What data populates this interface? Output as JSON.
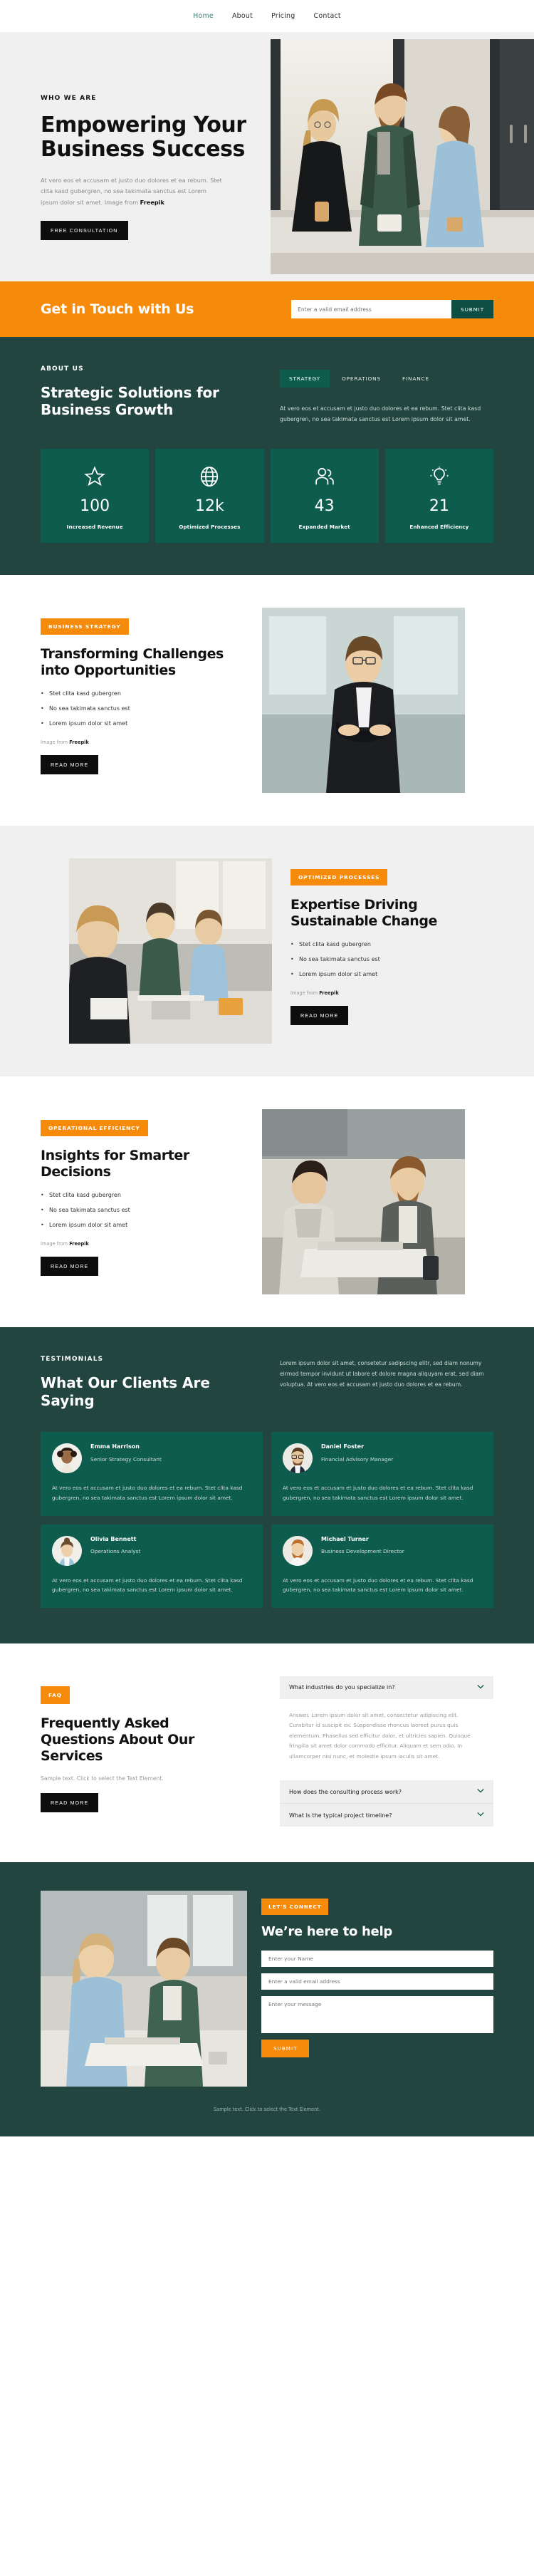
{
  "nav": {
    "items": [
      {
        "label": "Home",
        "active": true
      },
      {
        "label": "About",
        "active": false
      },
      {
        "label": "Pricing",
        "active": false
      },
      {
        "label": "Contact",
        "active": false
      }
    ]
  },
  "hero": {
    "eyebrow": "WHO WE ARE",
    "title": "Empowering Your Business Success",
    "desc_1": "At vero eos et accusam et justo duo dolores et ea rebum. Stet clita kasd gubergren, no sea takimata sanctus est Lorem ipsum dolor sit amet. Image from ",
    "desc_credit": "Freepik",
    "button": "FREE CONSULTATION"
  },
  "cta": {
    "title": "Get in Touch with Us",
    "email_placeholder": "Enter a valid email address",
    "submit": "SUBMIT"
  },
  "about": {
    "eyebrow": "ABOUT US",
    "title": "Strategic Solutions for Business Growth",
    "tabs": [
      {
        "label": "STRATEGY",
        "active": true
      },
      {
        "label": "OPERATIONS",
        "active": false
      },
      {
        "label": "FINANCE",
        "active": false
      }
    ],
    "desc": "At vero eos et accusam et justo duo dolores et ea rebum. Stet clita kasd gubergren, no sea takimata sanctus est Lorem ipsum dolor sit amet.",
    "stats": [
      {
        "icon": "star-icon",
        "number": "100",
        "label": "Increased Revenue"
      },
      {
        "icon": "globe-icon",
        "number": "12k",
        "label": "Optimized Processes"
      },
      {
        "icon": "people-icon",
        "number": "43",
        "label": "Expanded Market"
      },
      {
        "icon": "lightbulb-icon",
        "number": "21",
        "label": "Enhanced Efficiency"
      }
    ]
  },
  "features": [
    {
      "badge": "BUSINESS STRATEGY",
      "title": "Transforming Challenges into Opportunities",
      "bullets": [
        "Stet clita kasd gubergren",
        "No sea takimata sanctus est",
        "Lorem ipsum dolor sit amet"
      ],
      "credit_prefix": "Image from ",
      "credit": "Freepik",
      "button": "READ MORE"
    },
    {
      "badge": "OPTIMIZED PROCESSES",
      "title": "Expertise Driving Sustainable Change",
      "bullets": [
        "Stet clita kasd gubergren",
        "No sea takimata sanctus est",
        "Lorem ipsum dolor sit amet"
      ],
      "credit_prefix": "Image from ",
      "credit": "Freepik",
      "button": "READ MORE"
    },
    {
      "badge": "OPERATIONAL EFFICIENCY",
      "title": "Insights for Smarter Decisions",
      "bullets": [
        "Stet clita kasd gubergren",
        "No sea takimata sanctus est",
        "Lorem ipsum dolor sit amet"
      ],
      "credit_prefix": "Image from ",
      "credit": "Freepik",
      "button": "READ MORE"
    }
  ],
  "testimonials": {
    "eyebrow": "TESTIMONIALS",
    "title": "What Our Clients Are Saying",
    "intro": "Lorem ipsum dolor sit amet, consetetur sadipscing elitr, sed diam nonumy eirmod tempor invidunt ut labore et dolore magna aliquyam erat, sed diam voluptua. At vero eos et accusam et justo duo dolores et ea rebum.",
    "body": "At vero eos et accusam et justo duo dolores et ea rebum. Stet clita kasd gubergren, no sea takimata sanctus est Lorem ipsum dolor sit amet.",
    "cards": [
      {
        "name": "Emma Harrison",
        "role": "Senior Strategy Consultant"
      },
      {
        "name": "Daniel Foster",
        "role": "Financial Advisory Manager"
      },
      {
        "name": "Olivia Bennett",
        "role": "Operations Analyst"
      },
      {
        "name": "Michael Turner",
        "role": "Business Development Director"
      }
    ]
  },
  "faq": {
    "badge": "FAQ",
    "title": "Frequently Asked Questions About Our Services",
    "subtitle": "Sample text. Click to select the Text Element.",
    "button": "READ MORE",
    "open_question": "What industries do you specialize in?",
    "open_answer": "Answer. Lorem ipsum dolor sit amet, consectetur adipiscing elit. Curabitur id suscipit ex. Suspendisse rhoncus laoreet purus quis elementum. Phasellus sed efficitur dolor, et ultricies sapien. Quisque fringilla sit amet dolor commodo efficitur. Aliquam et sem odio. In ullamcorper nisi nunc, et molestie ipsum iaculis sit amet.",
    "closed_questions": [
      "How does the consulting process work?",
      "What is the typical project timeline?"
    ],
    "chevron": "chevron-down-icon"
  },
  "contact": {
    "badge": "LET'S CONNECT",
    "title": "We’re here to help",
    "name_placeholder": "Enter your Name",
    "email_placeholder": "Enter a valid email address",
    "message_placeholder": "Enter your message",
    "submit": "SUBMIT"
  },
  "footer": {
    "note": "Sample text. Click to select the Text Element."
  },
  "colors": {
    "orange": "#f58a0b",
    "teal_dark": "#22453f",
    "teal_card": "#0d5c4e",
    "black": "#0d0d0d",
    "grey_bg": "#f0f0f0",
    "nav_active": "#3f7f75"
  }
}
